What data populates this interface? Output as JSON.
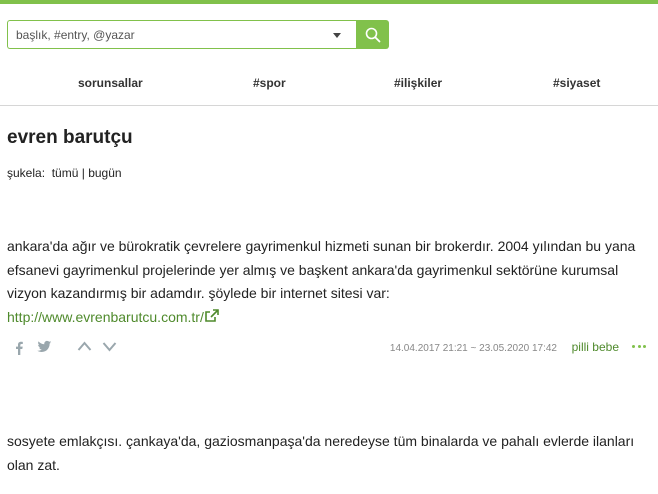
{
  "search": {
    "placeholder": "başlık, #entry, @yazar"
  },
  "nav": {
    "topics": [
      {
        "label": "sorunsallar"
      },
      {
        "label": "#spor"
      },
      {
        "label": "#ilişkiler"
      },
      {
        "label": "#siyaset"
      }
    ]
  },
  "topic": {
    "title": "evren barutçu",
    "sukela_label": "şukela:",
    "filter_all": "tümü",
    "filter_sep": "|",
    "filter_today": "bugün"
  },
  "entries": [
    {
      "text": "ankara'da ağır ve bürokratik çevrelere gayrimenkul hizmeti sunan bir brokerdır. 2004 yılından bu yana efsanevi gayrimenkul projelerinde yer almış ve başkent ankara'da gayrimenkul sektörüne kurumsal vizyon kazandırmış bir adamdır. şöylede bir internet sitesi var:",
      "link": "http://www.evrenbarutcu.com.tr/",
      "date": "14.04.2017 21:21 ~ 23.05.2020 17:42",
      "author": "pilli bebe"
    },
    {
      "text": "sosyete emlakçısı. çankaya'da, gaziosmanpaşa'da neredeyse tüm binalarda ve pahalı evlerde ilanları olan zat."
    }
  ],
  "icons": {
    "search": "search-icon",
    "facebook": "facebook-icon",
    "twitter": "twitter-icon",
    "upvote": "chevron-up-icon",
    "downvote": "chevron-down-icon",
    "external": "external-link-icon",
    "more": "more-dots-icon"
  },
  "colors": {
    "accent": "#81c14b",
    "link": "#4f8a2c"
  }
}
